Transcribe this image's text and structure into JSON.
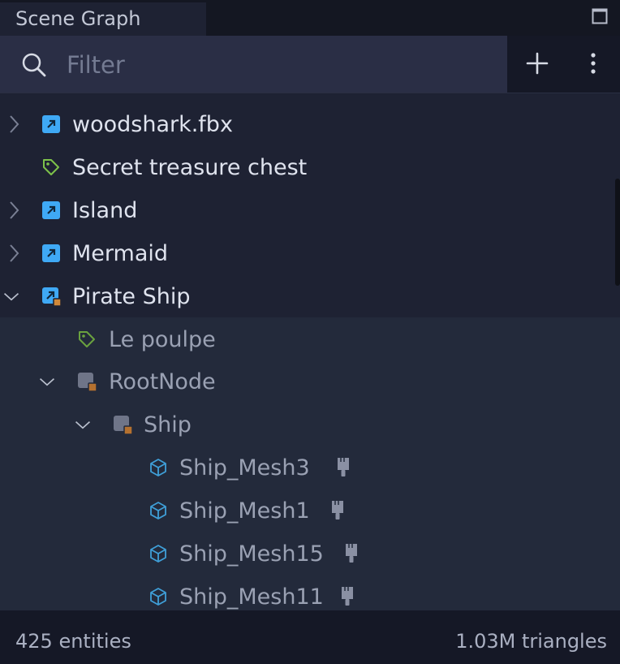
{
  "panel": {
    "title": "Scene Graph"
  },
  "filter": {
    "placeholder": "Filter",
    "value": ""
  },
  "tree": {
    "items": [
      {
        "label": "woodshark.fbx",
        "icon": "asset-link-icon"
      },
      {
        "label": "Secret treasure chest",
        "icon": "tag-icon"
      },
      {
        "label": "Island",
        "icon": "asset-link-icon"
      },
      {
        "label": "Mermaid",
        "icon": "asset-link-icon"
      },
      {
        "label": "Pirate Ship",
        "icon": "asset-link-modified-icon"
      },
      {
        "label": "Le poulpe",
        "icon": "tag-icon"
      },
      {
        "label": "RootNode",
        "icon": "node-icon"
      },
      {
        "label": "Ship",
        "icon": "node-icon"
      },
      {
        "label": "Ship_Mesh3",
        "icon": "mesh-cube-icon"
      },
      {
        "label": "Ship_Mesh1",
        "icon": "mesh-cube-icon"
      },
      {
        "label": "Ship_Mesh15",
        "icon": "mesh-cube-icon"
      },
      {
        "label": "Ship_Mesh11",
        "icon": "mesh-cube-icon"
      }
    ]
  },
  "status": {
    "entities": "425 entities",
    "triangles": "1.03M triangles"
  },
  "colors": {
    "asset_blue": "#3fa9f5",
    "tag_green": "#7dc24a",
    "node_gray": "#6f7588",
    "modified_orange": "#d0883a",
    "mesh_blue": "#3f9fd8"
  }
}
